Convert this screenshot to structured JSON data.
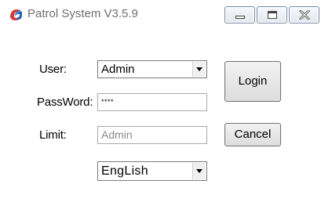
{
  "window": {
    "title": "Patrol System V3.5.9",
    "app_icon": "patrol-logo-icon",
    "controls": {
      "minimize_icon": "minimize-icon",
      "maximize_icon": "maximize-icon",
      "close_icon": "close-icon"
    }
  },
  "form": {
    "user": {
      "label": "User:",
      "value": "Admin",
      "dropdown_icon": "chevron-down-icon"
    },
    "password": {
      "label": "PassWord:",
      "masked_value": "****"
    },
    "limit": {
      "label": "Limit:",
      "value": "Admin"
    },
    "language": {
      "value": "EngLish",
      "dropdown_icon": "chevron-down-icon"
    }
  },
  "buttons": {
    "login_label": "Login",
    "cancel_label": "Cancel"
  },
  "colors": {
    "title_text": "#6f6f6f",
    "logo_red": "#d63b35",
    "logo_blue": "#2563b5",
    "disabled_text": "#8a8a8a",
    "close_glyph": "#5a5a5a"
  }
}
